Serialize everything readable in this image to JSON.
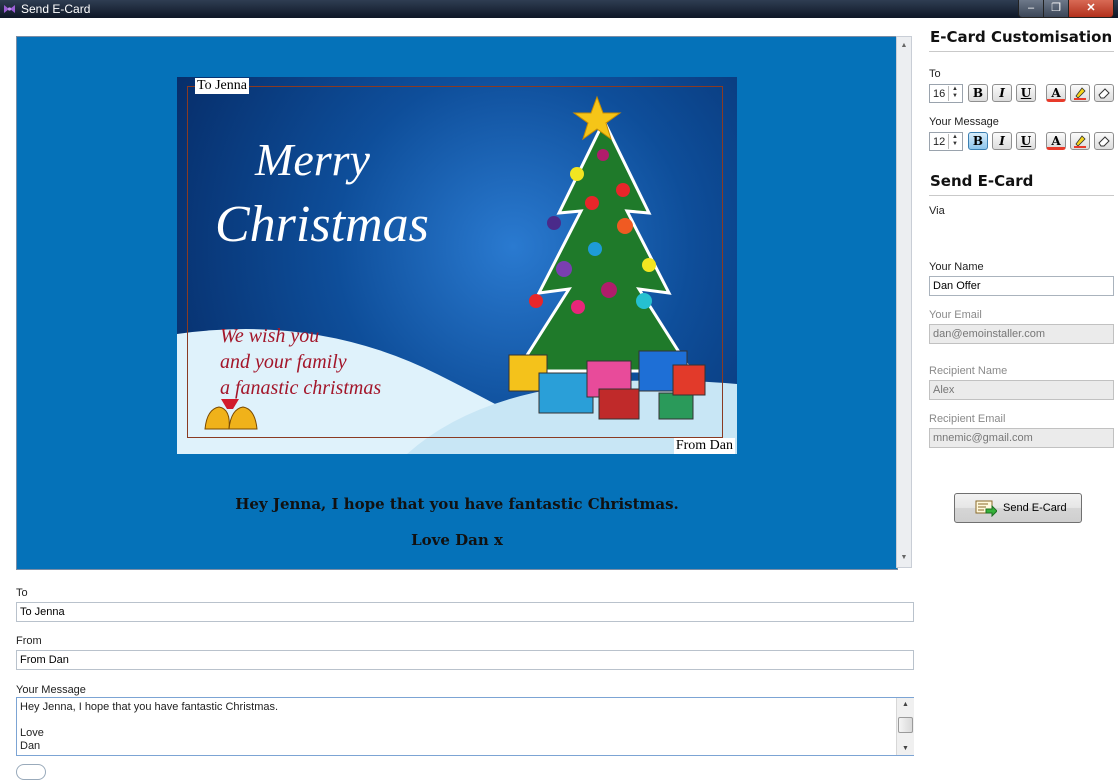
{
  "window": {
    "title": "Send E-Card",
    "minimize_glyph": "–",
    "maximize_glyph": "❐",
    "close_glyph": "✕"
  },
  "card": {
    "to_overlay": "To Jenna",
    "from_overlay": "From Dan",
    "heading_line1": "Merry",
    "heading_line2": "Christmas",
    "wish_line1": "We wish you",
    "wish_line2": "and your family",
    "wish_line3": "a fanastic christmas",
    "message_line1": "Hey Jenna, I hope that you have fantastic Christmas.",
    "message_line2": "Love Dan x"
  },
  "fields": {
    "to_label": "To",
    "to_value": "To Jenna",
    "from_label": "From",
    "from_value": "From Dan",
    "message_label": "Your Message",
    "message_value": "Hey Jenna, I hope that you have fantastic Christmas.\n\nLove\nDan"
  },
  "customisation": {
    "heading": "E-Card Customisation",
    "to_label": "To",
    "to_font_size": "16",
    "message_label": "Your Message",
    "message_font_size": "12",
    "bold_label": "B",
    "italic_label": "I",
    "underline_label": "U",
    "font_color_label": "A"
  },
  "send": {
    "heading": "Send E-Card",
    "via_label": "Via",
    "your_name_label": "Your Name",
    "your_name_value": "Dan Offer",
    "your_email_label": "Your Email",
    "your_email_value": "dan@emoinstaller.com",
    "recipient_name_label": "Recipient Name",
    "recipient_name_value": "Alex",
    "recipient_email_label": "Recipient Email",
    "recipient_email_value": "mnemic@gmail.com",
    "button_label": "Send E-Card"
  },
  "colors": {
    "preview_background": "#0572b9",
    "card_wish_text": "#a3162a",
    "active_button": "#8cc4ec"
  },
  "icons": [
    "app-icon",
    "bold-icon",
    "italic-icon",
    "underline-icon",
    "font-color-icon",
    "highlight-icon",
    "eraser-icon",
    "send-ecard-icon"
  ]
}
